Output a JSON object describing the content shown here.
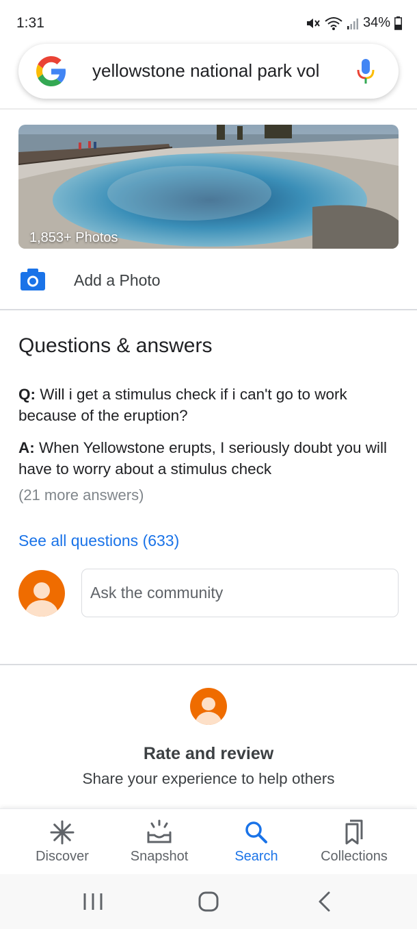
{
  "status_bar": {
    "time": "1:31",
    "battery": "34%"
  },
  "search": {
    "query": "yellowstone national park vol"
  },
  "photos": {
    "count_label": "1,853+ Photos",
    "add_photo_label": "Add a Photo"
  },
  "qa": {
    "title": "Questions & answers",
    "question_prefix": "Q:",
    "question": "Will i get a stimulus check if i can't go to work because of the eruption?",
    "answer_prefix": "A:",
    "answer": "When Yellowstone erupts, I seriously doubt you will have to worry about a stimulus check",
    "more_answers": "(21 more answers)",
    "see_all": "See all questions (633)",
    "ask_placeholder": "Ask the community"
  },
  "review": {
    "title": "Rate and review",
    "subtitle": "Share your experience to help others"
  },
  "bottom_nav": {
    "items": [
      {
        "label": "Discover",
        "icon": "asterisk-icon"
      },
      {
        "label": "Snapshot",
        "icon": "snapshot-icon"
      },
      {
        "label": "Search",
        "icon": "search-icon",
        "active": true
      },
      {
        "label": "Collections",
        "icon": "collections-icon"
      }
    ]
  },
  "colors": {
    "accent": "#1a73e8",
    "avatar": "#ef6c00",
    "text": "#202124",
    "muted": "#80868b"
  }
}
